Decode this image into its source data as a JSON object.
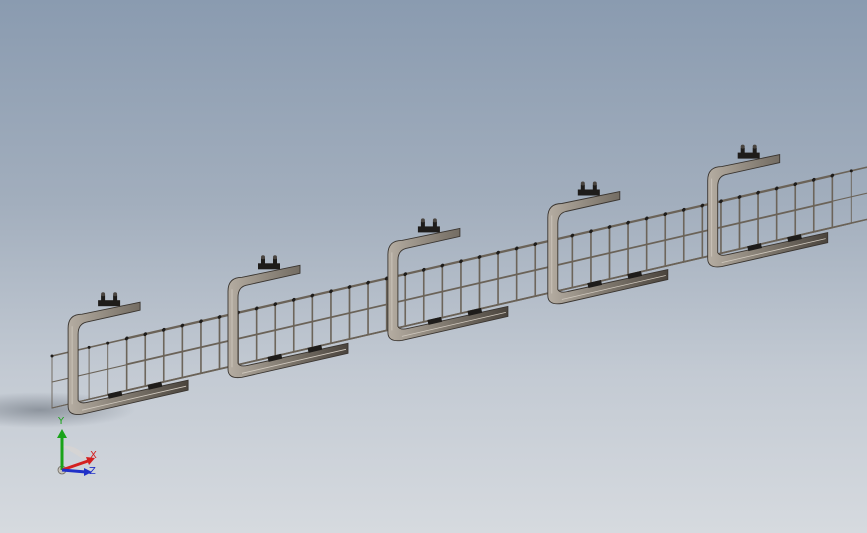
{
  "viewport": {
    "background_top": "#8a9bb0",
    "background_bottom": "#d6dadf"
  },
  "model": {
    "tray_count": 5,
    "wire_color": "#6b6358",
    "bracket_color": "#3a3530",
    "bracket_fill": "#8c857b",
    "clamp_color": "#1e1c1a"
  },
  "triad": {
    "y_label": "Y",
    "x_label": "X",
    "z_label": "Z",
    "y_color": "#1aa31a",
    "x_color": "#d42020",
    "z_color": "#2030c8"
  }
}
